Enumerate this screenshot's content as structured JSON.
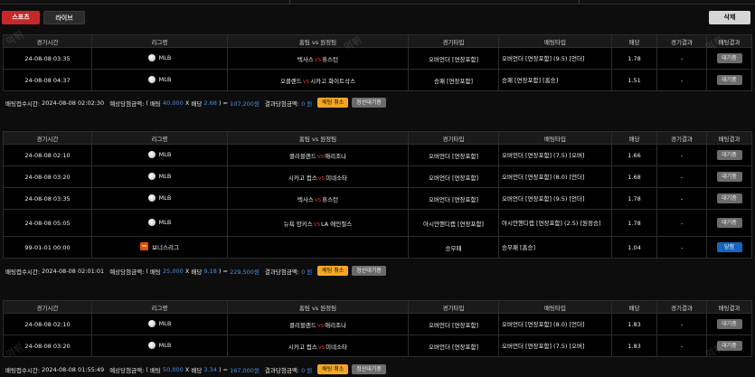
{
  "tabs": {
    "sports": "스포츠",
    "live": "라이브"
  },
  "delete_label": "삭제",
  "columns": [
    "경기시간",
    "리그명",
    "홈팀 vs 원정팀",
    "경기타입",
    "배팅타입",
    "배당",
    "경기결과",
    "배팅결과"
  ],
  "vs_label": "VS",
  "labels": {
    "bet_time": "배팅접수시간:",
    "expected": "예상당첨금액:",
    "bet": "배팅",
    "odds": "배당",
    "result_amount": "결과당첨금액:",
    "cancel": "배팅 취소",
    "settle_wait": "정산대기중"
  },
  "slips": [
    {
      "rows": [
        {
          "time": "24-08-08 03:35",
          "league": "MLB",
          "icon": "baseball-icon",
          "home": "텍사스",
          "away": "휴스턴",
          "game_type": "오버언더 [연장포함]",
          "bet_type": "오버언더 [연장포함] (9.5) [언더]",
          "odds": "1.78",
          "result": "-",
          "status": "대기중"
        },
        {
          "time": "24-08-08 04:37",
          "league": "MLB",
          "icon": "baseball-icon",
          "home": "오클랜드",
          "away": "시카고 화이트삭스",
          "game_type": "승패 [연장포함]",
          "bet_type": "승패 [연장포함] [홈승]",
          "odds": "1.51",
          "result": "-",
          "status": "대기중"
        }
      ],
      "summary": {
        "time": "2024-08-08 02:02:30",
        "stake": "40,000",
        "odds": "2.68",
        "amount": "107,200원",
        "result": "0 원"
      }
    },
    {
      "rows": [
        {
          "time": "24-08-08 02:10",
          "league": "MLB",
          "icon": "baseball-icon",
          "home": "클리블랜드",
          "away": "애리조나",
          "game_type": "오버언더 [연장포함]",
          "bet_type": "오버언더 [연장포함] (7.5) [오버]",
          "odds": "1.66",
          "result": "-",
          "status": "대기중"
        },
        {
          "time": "24-08-08 03:20",
          "league": "MLB",
          "icon": "baseball-icon",
          "home": "시카고 컵스",
          "away": "미네소타",
          "game_type": "오버언더 [연장포함]",
          "bet_type": "오버언더 [연장포함] (8.0) [언더]",
          "odds": "1.68",
          "result": "-",
          "status": "대기중"
        },
        {
          "time": "24-08-08 03:35",
          "league": "MLB",
          "icon": "baseball-icon",
          "home": "텍사스",
          "away": "휴스턴",
          "game_type": "오버언더 [연장포함]",
          "bet_type": "오버언더 [연장포함] (9.5) [언더]",
          "odds": "1.78",
          "result": "-",
          "status": "대기중"
        },
        {
          "time": "24-08-08 05:05",
          "league": "MLB",
          "icon": "baseball-icon",
          "home": "뉴욕 양키스",
          "away": "LA 에인절스",
          "game_type": "아시안핸디캡 [연장포함]",
          "bet_type": "아시안핸디캡 [연장포함] (2.5) [원정승]",
          "odds": "1.78",
          "result": "-",
          "status": "대기중",
          "tall": true
        },
        {
          "time": "99-01-01 00:00",
          "league": "보너스리그",
          "icon": "bonus-icon",
          "home": "",
          "away": "",
          "game_type": "승무패",
          "bet_type": "승무패 [홈승]",
          "odds": "1.04",
          "result": "-",
          "status": "당첨",
          "win": true
        }
      ],
      "summary": {
        "time": "2024-08-08 02:01:01",
        "stake": "25,000",
        "odds": "9.18",
        "amount": "229,500원",
        "result": "0 원"
      }
    },
    {
      "rows": [
        {
          "time": "24-08-08 02:10",
          "league": "MLB",
          "icon": "baseball-icon",
          "home": "클리블랜드",
          "away": "애리조나",
          "game_type": "오버언더 [연장포함]",
          "bet_type": "오버언더 [연장포함] (8.0) [언더]",
          "odds": "1.83",
          "result": "-",
          "status": "대기중"
        },
        {
          "time": "24-08-08 03:20",
          "league": "MLB",
          "icon": "baseball-icon",
          "home": "시카고 컵스",
          "away": "미네소타",
          "game_type": "오버언더 [연장포함]",
          "bet_type": "오버언더 [연장포함] (7.5) [오버]",
          "odds": "1.83",
          "result": "-",
          "status": "대기중"
        }
      ],
      "summary": {
        "time": "2024-08-08 01:55:49",
        "stake": "50,000",
        "odds": "3.34",
        "amount": "167,000원",
        "result": "0 원"
      }
    }
  ]
}
